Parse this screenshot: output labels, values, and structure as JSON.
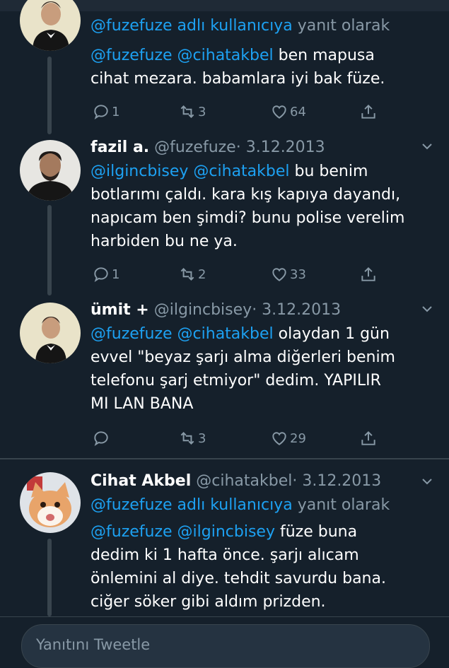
{
  "tweets": [
    {
      "reply_to": {
        "handle": "@fuzefuze adlı kullanıcıya",
        "suffix": "yanıt olarak"
      },
      "text": [
        [
          {
            "t": "@fuzefuze @cihatakbel",
            "m": true
          },
          {
            "t": " ben mapusa",
            "m": false
          }
        ],
        [
          {
            "t": "cihat mezara. babamlara iyi bak füze.",
            "m": false
          }
        ]
      ],
      "counts": {
        "reply": "1",
        "retweet": "3",
        "like": "64"
      }
    },
    {
      "name": "fazil a.",
      "handle": "@fuzefuze",
      "date": "· 3.12.2013",
      "text": [
        [
          {
            "t": "@ilgincbisey @cihatakbel",
            "m": true
          },
          {
            "t": " bu benim",
            "m": false
          }
        ],
        [
          {
            "t": "botlarımı çaldı. kara kış kapıya dayandı,",
            "m": false
          }
        ],
        [
          {
            "t": "napıcam ben şimdi? bunu polise verelim",
            "m": false
          }
        ],
        [
          {
            "t": "harbiden bu ne ya.",
            "m": false
          }
        ]
      ],
      "counts": {
        "reply": "1",
        "retweet": "2",
        "like": "33"
      }
    },
    {
      "name": "ümit +",
      "handle": "@ilgincbisey",
      "date": "· 3.12.2013",
      "text": [
        [
          {
            "t": "@fuzefuze @cihatakbel",
            "m": true
          },
          {
            "t": " olaydan 1 gün",
            "m": false
          }
        ],
        [
          {
            "t": "evvel \"beyaz şarjı alma diğerleri benim",
            "m": false
          }
        ],
        [
          {
            "t": "telefonu şarj etmiyor\" dedim. YAPILIR",
            "m": false
          }
        ],
        [
          {
            "t": "MI LAN BANA",
            "m": false
          }
        ]
      ],
      "counts": {
        "reply": "",
        "retweet": "3",
        "like": "29"
      }
    },
    {
      "name": "Cihat Akbel",
      "handle": "@cihatakbel",
      "date": "· 3.12.2013",
      "reply_to": {
        "handle": "@fuzefuze adlı kullanıcıya",
        "suffix": "yanıt olarak"
      },
      "text": [
        [
          {
            "t": "@fuzefuze @ilgincbisey",
            "m": true
          },
          {
            "t": " füze buna",
            "m": false
          }
        ],
        [
          {
            "t": "dedim ki 1 hafta önce. şarjı alıcam",
            "m": false
          }
        ],
        [
          {
            "t": "önlemini al diye. tehdit savurdu bana.",
            "m": false
          }
        ],
        [
          {
            "t": "ciğer söker gibi aldım prizden.",
            "m": false
          }
        ]
      ]
    }
  ],
  "reply_box": {
    "placeholder": "Yanıtını Tweetle"
  },
  "colors": {
    "background": "#15202b",
    "accent": "#1da1f2",
    "secondary": "#8899a6"
  },
  "icons": [
    "reply-icon",
    "retweet-icon",
    "like-icon",
    "share-icon",
    "chevron-down-icon"
  ]
}
